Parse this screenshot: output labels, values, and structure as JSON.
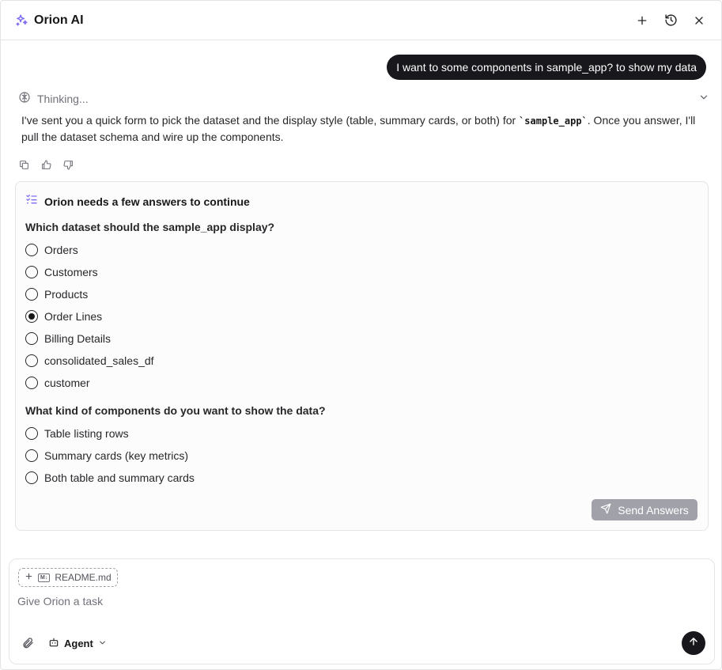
{
  "header": {
    "title": "Orion AI",
    "logo_icon": "sparkles-icon",
    "actions": [
      "plus-icon",
      "history-icon",
      "close-icon"
    ],
    "accent": "#7c6cf2"
  },
  "conversation": {
    "user_message": "I want to some components in sample_app? to show my data",
    "thinking_label": "Thinking...",
    "assistant_text_before": "I've sent you a quick form to pick the dataset and the display style (table, summary cards, or both) for ",
    "assistant_code": "`sample_app`",
    "assistant_text_after": ". Once you answer, I'll pull the dataset schema and wire up the components."
  },
  "form": {
    "title": "Orion needs a few answers to continue",
    "q1": {
      "label": "Which dataset should the sample_app display?",
      "options": [
        "Orders",
        "Customers",
        "Products",
        "Order Lines",
        "Billing Details",
        "consolidated_sales_df",
        "customer"
      ],
      "selected": "Order Lines"
    },
    "q2": {
      "label": "What kind of components do you want to show the data?",
      "options": [
        "Table listing rows",
        "Summary cards (key metrics)",
        "Both table and summary cards"
      ],
      "selected": null
    },
    "send_label": "Send Answers"
  },
  "composer": {
    "chip_label": "README.md",
    "chip_badge": "M↓",
    "placeholder": "Give Orion a task",
    "mode_label": "Agent"
  }
}
